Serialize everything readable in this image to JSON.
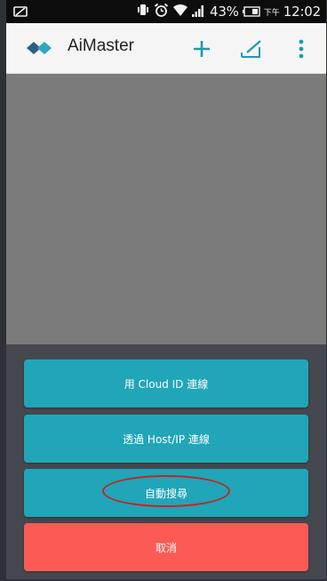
{
  "status_bar": {
    "battery_percent": "43%",
    "ampm": "下午",
    "time": "12:02"
  },
  "action_bar": {
    "title": "AiMaster",
    "logo_icon": "aimaster-logo-icon",
    "actions": [
      "add-icon",
      "edit-icon",
      "overflow-menu-icon"
    ]
  },
  "connect_sheet": {
    "cloud_id_label": "用 Cloud ID 連線",
    "host_ip_label": "透過 Host/IP 連線",
    "auto_search_label": "自動搜尋",
    "cancel_label": "取消"
  },
  "colors": {
    "accent_teal": "#20a5b9",
    "cancel_red": "#fb5a55",
    "highlight_circle": "#c8231e"
  }
}
